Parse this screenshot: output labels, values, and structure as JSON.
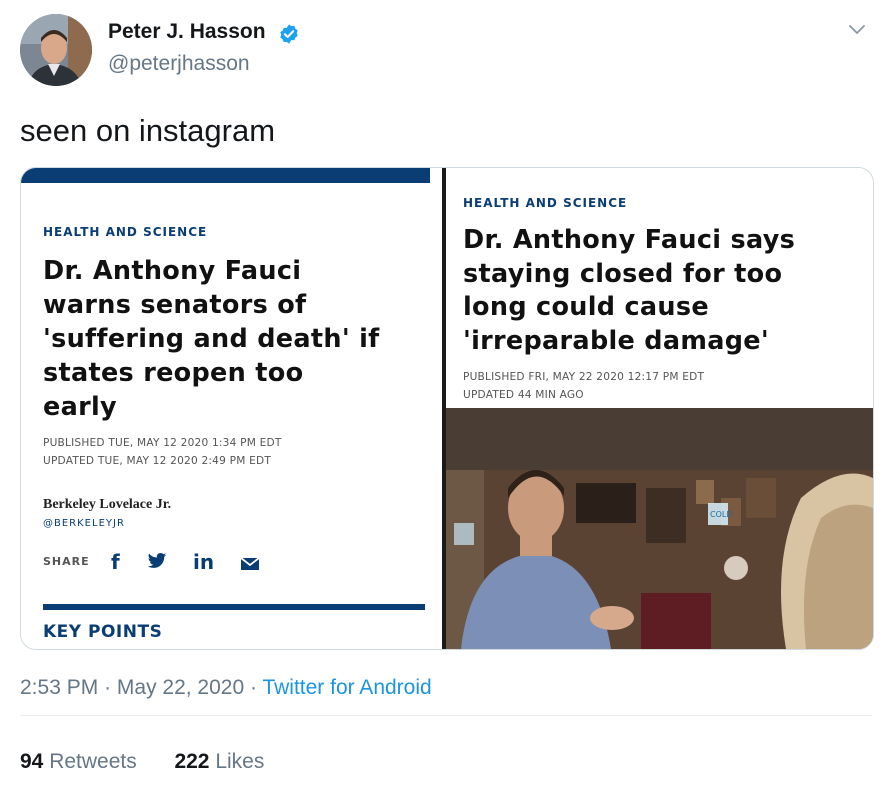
{
  "author": {
    "display_name": "Peter J. Hasson",
    "handle": "@peterjhasson"
  },
  "tweet": {
    "text": "seen on instagram"
  },
  "media": {
    "left_card": {
      "section": "HEALTH AND SCIENCE",
      "headline_lines": [
        "Dr. Anthony Fauci",
        "warns senators of",
        "'suffering and death' if",
        "states reopen too",
        "early"
      ],
      "published": "PUBLISHED TUE, MAY 12 2020 1:34 PM EDT",
      "updated": "UPDATED TUE, MAY 12 2020 2:49 PM EDT",
      "byline": "Berkeley Lovelace Jr.",
      "byline_handle": "@BERKELEYJR",
      "share_label": "SHARE",
      "share_icons": {
        "facebook": "f",
        "twitter": "twitter-bird-icon",
        "linkedin": "in",
        "email": "envelope-icon"
      },
      "key_points": "KEY POINTS"
    },
    "right_card": {
      "section": "HEALTH AND SCIENCE",
      "headline_lines": [
        "Dr. Anthony Fauci says",
        "staying closed for too",
        "long could cause",
        "'irreparable damage'"
      ],
      "published": "PUBLISHED FRI, MAY 22 2020 12:17 PM EDT",
      "updated": "UPDATED 44 MIN AGO"
    },
    "sign_text": "COLD"
  },
  "footer": {
    "time": "2:53 PM",
    "date": "May 22, 2020",
    "source": "Twitter for Android",
    "retweets_count": "94",
    "retweets_label": "Retweets",
    "likes_count": "222",
    "likes_label": "Likes"
  },
  "colors": {
    "brand_navy": "#0a3d74",
    "twitter_blue": "#1b95e0",
    "verified_blue": "#1da1f2",
    "muted_text": "#657786"
  }
}
